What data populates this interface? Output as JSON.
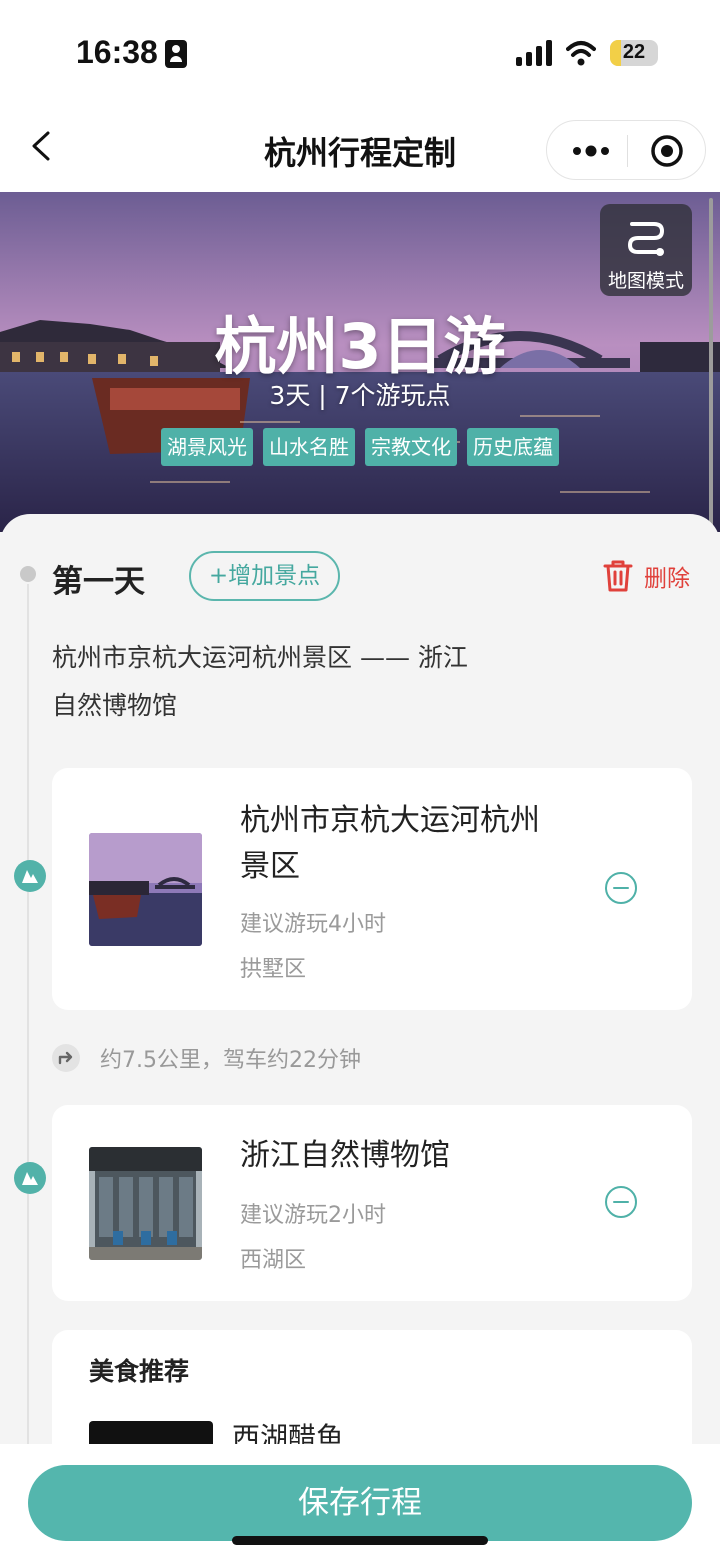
{
  "status_bar": {
    "time": "16:38",
    "battery": "22",
    "battery_level": 0.22
  },
  "nav": {
    "title": "杭州行程定制"
  },
  "hero": {
    "title": "杭州3日游",
    "subtitle": "3天 | 7个游玩点",
    "tags": [
      "湖景风光",
      "山水名胜",
      "宗教文化",
      "历史底蕴"
    ],
    "map_mode_label": "地图模式"
  },
  "day": {
    "label": "第一天",
    "add_label": "+增加景点",
    "delete_label": "删除",
    "route_text": "杭州市京杭大运河杭州景区 —— 浙江自然博物馆"
  },
  "spots": [
    {
      "name": "杭州市京杭大运河杭州景区",
      "duration": "建议游玩4小时",
      "district": "拱墅区"
    },
    {
      "name": "浙江自然博物馆",
      "duration": "建议游玩2小时",
      "district": "西湖区"
    }
  ],
  "travel": {
    "text": "约7.5公里，驾车约22分钟"
  },
  "food": {
    "title": "美食推荐",
    "items": [
      "西湖醋鱼"
    ]
  },
  "save_label": "保存行程",
  "colors": {
    "accent": "#54b6ad",
    "danger": "#e0413b",
    "tag": "#4fb1a8"
  }
}
